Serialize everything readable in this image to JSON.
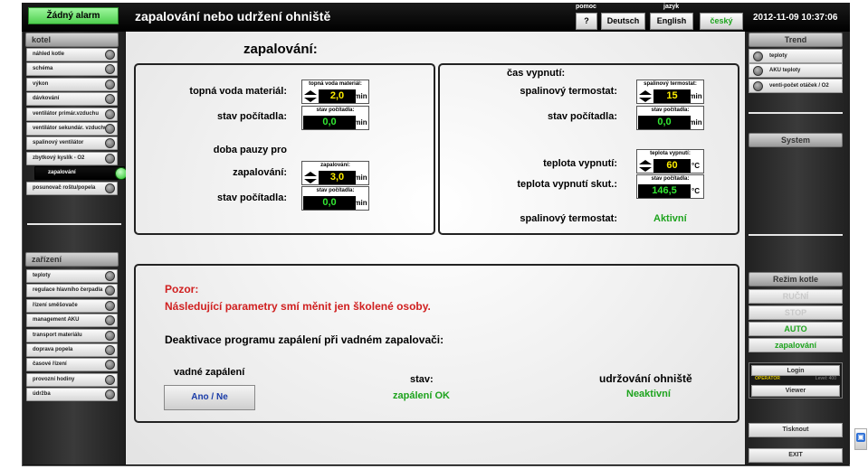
{
  "header": {
    "alarm": "Žádný alarm",
    "title": "zapalování nebo udržení ohniště",
    "help_label": "pomoc",
    "help_button": "?",
    "language_label": "jazyk",
    "languages": [
      "Deutsch",
      "English",
      "český"
    ],
    "datetime": "2012-11-09 10:37:06"
  },
  "left_sidebar": {
    "kotel_header": "kotel",
    "kotel_items": [
      {
        "label": "náhled kotle"
      },
      {
        "label": "schéma"
      },
      {
        "label": "výkon"
      },
      {
        "label": "dávkování"
      },
      {
        "label": "ventilátor primár.vzduchu"
      },
      {
        "label": "ventilátor sekundár. vzduchu"
      },
      {
        "label": "spalinový ventilátor"
      },
      {
        "label": "zbytkový kyslík - O2"
      },
      {
        "label": "zapalování"
      },
      {
        "label": "posunovač roštu/popela"
      }
    ],
    "zarizeni_header": "zařízení",
    "zarizeni_items": [
      {
        "label": "teploty"
      },
      {
        "label": "regulace hlavního čerpadla"
      },
      {
        "label": "řízení směšovače"
      },
      {
        "label": "management AKU"
      },
      {
        "label": "transport materiálu"
      },
      {
        "label": "doprava popela"
      },
      {
        "label": "časové řízení"
      },
      {
        "label": "provozní hodiny"
      },
      {
        "label": "údržba"
      }
    ]
  },
  "right_sidebar": {
    "trend_header": "Trend",
    "trend_items": [
      "teploty",
      "AKU teploty",
      "venti-počet otáček / O2"
    ],
    "system_header": "System",
    "mode_header": "Režim kotle",
    "modes": [
      "RUČNÍ",
      "STOP",
      "AUTO",
      "zapalování"
    ],
    "login_label": "Login",
    "operator_text": "OPERATOR",
    "level_text": "Level: 400",
    "viewer_label": "Viewer",
    "print_label": "Tisknout",
    "exit_label": "EXIT"
  },
  "main": {
    "heading": "zapalování:",
    "left_panel": {
      "topna_label": "topná voda materiál:",
      "topna_box_title": "topná voda materiál:",
      "topna_value": "2,0",
      "topna_unit": "min",
      "stav1_label": "stav počítadla:",
      "stav1_box_title": "stav počítadla:",
      "stav1_value": "0,0",
      "stav1_unit": "min",
      "doba_label": "doba pauzy pro",
      "zapal_label": "zapalování:",
      "zapal_box_title": "zapalování:",
      "zapal_value": "3,0",
      "zapal_unit": "min",
      "stav2_label": "stav počítadla:",
      "stav2_box_title": "stav počítadla:",
      "stav2_value": "0,0",
      "stav2_unit": "min"
    },
    "right_panel": {
      "cas_label": "čas vypnutí:",
      "spal_label": "spalinový termostat:",
      "spal_box_title": "spalinový termostat:",
      "spal_value": "15",
      "spal_unit": "min",
      "stav_label": "stav počítadla:",
      "stav_box_title": "stav počítadla:",
      "stav_value": "0,0",
      "stav_unit": "min",
      "teplota_label": "teplota vypnutí:",
      "teplota_box_title": "teplota vypnutí:",
      "teplota_value": "60",
      "teplota_unit": "°C",
      "teplota_skut_label": "teplota vypnutí skut.:",
      "teplota_skut_box_title": "stav počítadla:",
      "teplota_skut_value": "146,5",
      "teplota_skut_unit": "°C",
      "spal_status_label": "spalinový termostat:",
      "spal_status_value": "Aktivní"
    },
    "bottom_panel": {
      "warning_title": "Pozor:",
      "warning_text": "Následující parametry smí měnit jen školené osoby.",
      "deact_text": "Deaktivace programu zapálení při vadném zapalovači:",
      "vadne_label": "vadné zapálení",
      "ano_ne_button": "Ano / Ne",
      "stav_label": "stav:",
      "stav_value": "zapálení OK",
      "udrzovani_label": "udržování ohniště",
      "udrzovani_value": "Neaktivní"
    }
  }
}
